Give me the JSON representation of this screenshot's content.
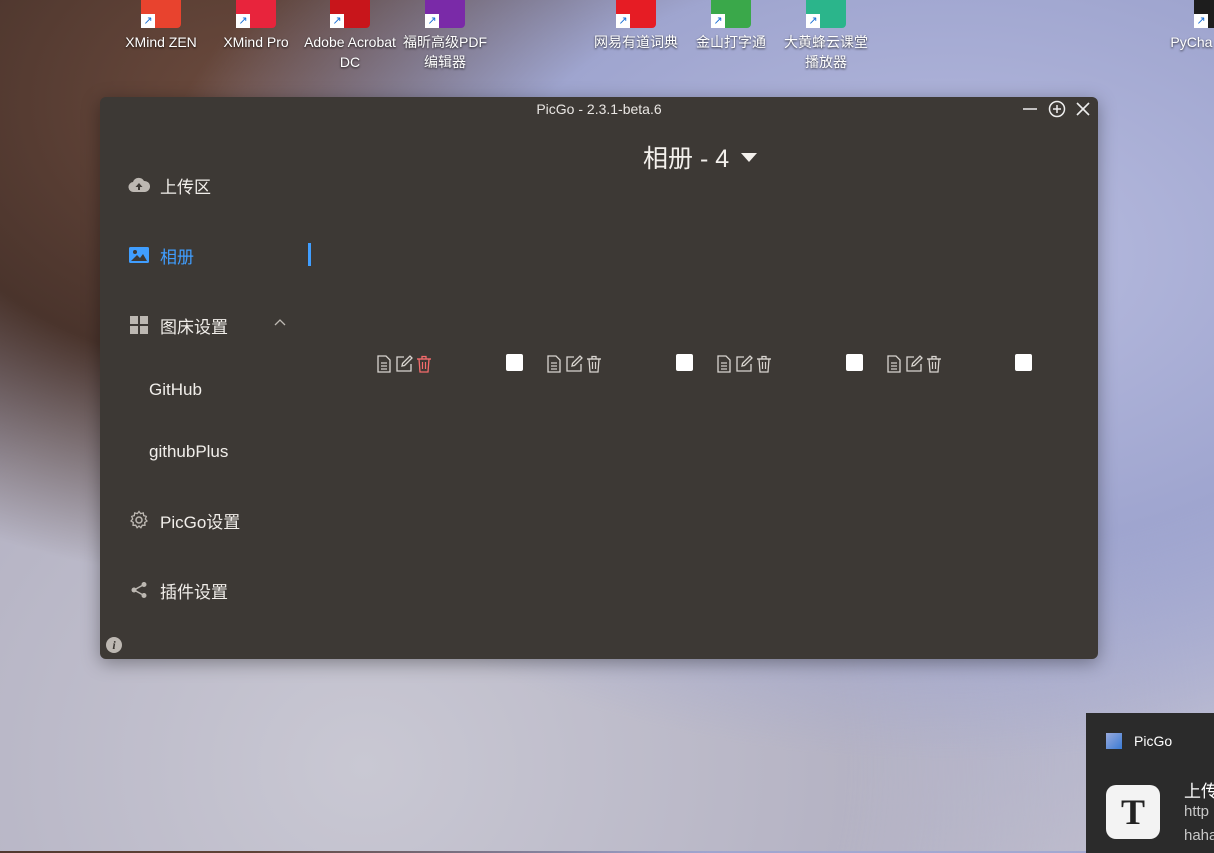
{
  "desktop": {
    "icons": [
      {
        "label": "XMind ZEN",
        "color": "#e8432e"
      },
      {
        "label": "XMind Pro",
        "color": "#e8243c"
      },
      {
        "label": "Adobe Acrobat DC",
        "color": "#c8151b"
      },
      {
        "label": "福昕高级PDF 编辑器",
        "color": "#7a2aa8"
      },
      {
        "label": "网易有道词典",
        "color": "#e61c24"
      },
      {
        "label": "金山打字通",
        "color": "#3aa84a"
      },
      {
        "label": "大黄蜂云课堂 播放器",
        "color": "#2bb58b"
      },
      {
        "label": "PyCha Comm",
        "color": "#1d1d1d"
      }
    ]
  },
  "window": {
    "title": "PicGo - 2.3.1-beta.6",
    "controls": [
      "minimize",
      "maximize",
      "close"
    ]
  },
  "sidebar": {
    "items": [
      {
        "label": "上传区",
        "icon": "cloud-upload-icon"
      },
      {
        "label": "相册",
        "icon": "picture-icon",
        "active": true
      },
      {
        "label": "图床设置",
        "icon": "grid-icon",
        "expanded": true
      },
      {
        "label": "PicGo设置",
        "icon": "gear-icon"
      },
      {
        "label": "插件设置",
        "icon": "share-icon"
      }
    ],
    "sub_items": [
      {
        "label": "GitHub"
      },
      {
        "label": "githubPlus"
      }
    ]
  },
  "gallery": {
    "title": "相册 - 4",
    "card_count": 4
  },
  "toast": {
    "app": "PicGo",
    "line1": "上传",
    "line2": "http",
    "line3": "haha"
  },
  "colors": {
    "accent": "#409eff",
    "window_bg": "#3d3935",
    "delete_hover": "#f56c6c"
  }
}
